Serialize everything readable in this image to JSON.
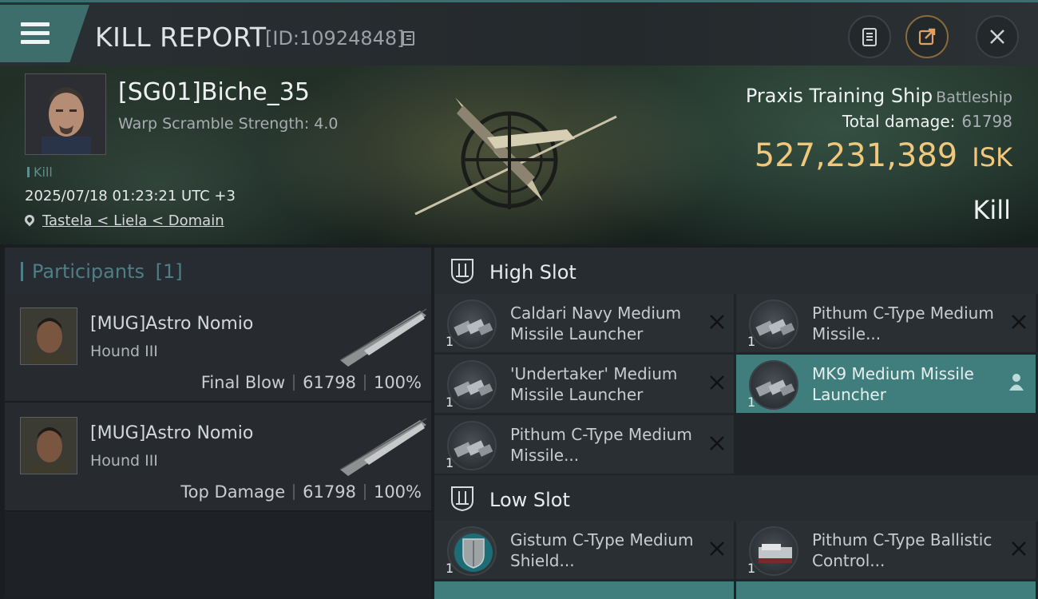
{
  "header": {
    "title": "KILL REPORT",
    "report_id": "[ID:10924848]"
  },
  "victim": {
    "name": "[SG01]Biche_35",
    "warp_scramble": "Warp Scramble Strength: 4.0",
    "kill_tag": "Kill",
    "time": "2025/07/18 01:23:21 UTC +3",
    "location": "Tastela < Liela < Domain"
  },
  "ship": {
    "name": "Praxis Training Ship",
    "class": "Battleship",
    "total_damage_label": "Total damage:",
    "total_damage": "61798",
    "isk_value": "527,231,389",
    "isk_unit": "ISK",
    "result": "Kill"
  },
  "participants": {
    "title": "Participants",
    "count": "[1]",
    "rows": [
      {
        "name": "[MUG]Astro Nomio",
        "ship": "Hound III",
        "role": "Final Blow",
        "damage": "61798",
        "percent": "100%"
      },
      {
        "name": "[MUG]Astro Nomio",
        "ship": "Hound III",
        "role": "Top Damage",
        "damage": "61798",
        "percent": "100%"
      }
    ]
  },
  "slots": {
    "high": {
      "label": "High Slot",
      "items": [
        {
          "name": "Caldari Navy Medium Missile Launcher",
          "qty": "1",
          "status": "destroyed"
        },
        {
          "name": "Pithum C-Type Medium Missile...",
          "qty": "1",
          "status": "destroyed"
        },
        {
          "name": "'Undertaker' Medium Missile Launcher",
          "qty": "1",
          "status": "destroyed"
        },
        {
          "name": "MK9 Medium Missile Launcher",
          "qty": "1",
          "status": "dropped"
        },
        {
          "name": "Pithum C-Type Medium Missile...",
          "qty": "1",
          "status": "destroyed"
        }
      ]
    },
    "low": {
      "label": "Low Slot",
      "items": [
        {
          "name": "Gistum C-Type Medium Shield...",
          "qty": "1",
          "status": "destroyed"
        },
        {
          "name": "Pithum C-Type Ballistic Control...",
          "qty": "1",
          "status": "destroyed"
        }
      ]
    }
  },
  "colors": {
    "accent_teal": "#3f7e7c",
    "isk_gold": "#f0c87c",
    "participants_title": "#4f7e86"
  }
}
